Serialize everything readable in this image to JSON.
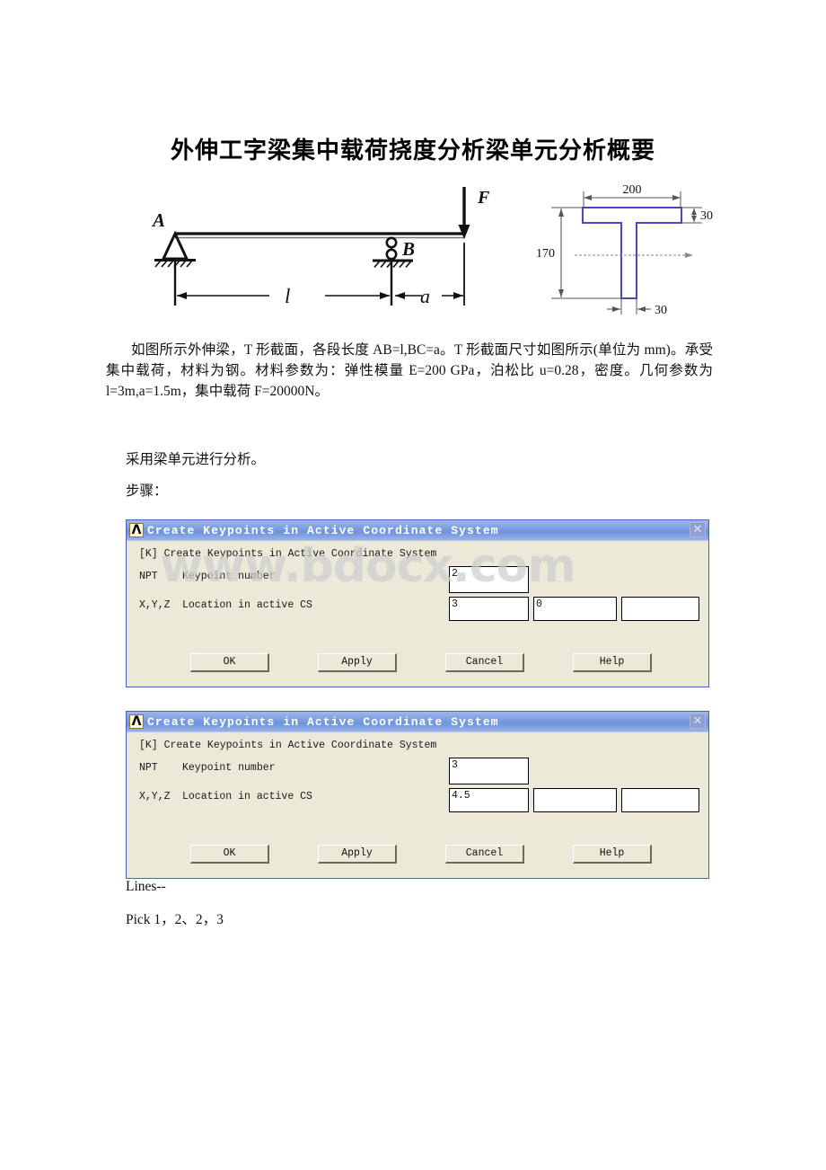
{
  "document": {
    "title": "外伸工字梁集中载荷挠度分析梁单元分析概要",
    "watermark": "www.bdocx.com",
    "paragraphs": {
      "problem": "如图所示外伸梁，T 形截面，各段长度 AB=l,BC=a。T 形截面尺寸如图所示(单位为 mm)。承受集中载荷，材料为钢。材料参数为：弹性模量 E=200 GPa，泊松比 u=0.28，密度。几何参数为 l=3m,a=1.5m，集中载荷 F=20000N。",
      "method": "采用梁单元进行分析。",
      "steps_label": "步骤：",
      "lines_label": "Lines--",
      "pick_label": "Pick 1，2、2，3"
    }
  },
  "beam_figure": {
    "label_A": "A",
    "label_B": "B",
    "label_F": "F",
    "label_l": "l",
    "label_a": "a"
  },
  "section_figure": {
    "dim_width": "200",
    "dim_flange_thickness": "30",
    "dim_height": "170",
    "dim_web_thickness": "30",
    "outline_color": "#4a4ab8"
  },
  "dialogs": [
    {
      "title": "Create Keypoints in Active Coordinate System",
      "logo": "ansys-logo",
      "close_label": "✕",
      "header": "[K]  Create Keypoints in Active Coordinate System",
      "npt_code": "NPT",
      "npt_label": "Keypoint number",
      "npt_value": "2",
      "xyz_code": "X,Y,Z",
      "xyz_label": "Location in active CS",
      "x_value": "3",
      "y_value": "0",
      "z_value": "",
      "buttons": {
        "ok": "OK",
        "apply": "Apply",
        "cancel": "Cancel",
        "help": "Help"
      }
    },
    {
      "title": "Create Keypoints in Active Coordinate System",
      "logo": "ansys-logo",
      "close_label": "✕",
      "header": "[K]  Create Keypoints in Active Coordinate System",
      "npt_code": "NPT",
      "npt_label": "Keypoint number",
      "npt_value": "3",
      "xyz_code": "X,Y,Z",
      "xyz_label": "Location in active CS",
      "x_value": "4.5",
      "y_value": "",
      "z_value": "",
      "buttons": {
        "ok": "OK",
        "apply": "Apply",
        "cancel": "Cancel",
        "help": "Help"
      }
    }
  ]
}
